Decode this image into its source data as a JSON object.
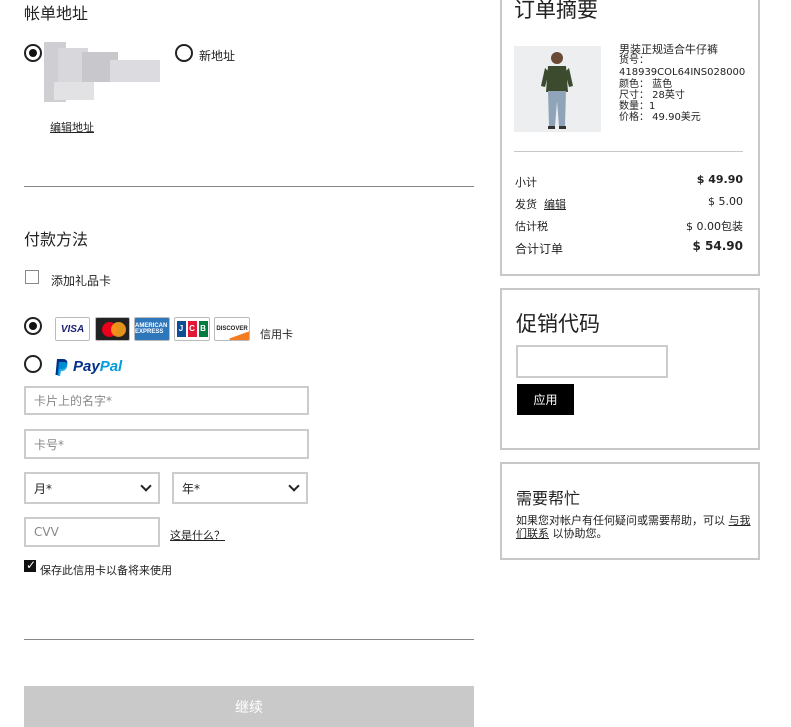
{
  "billing": {
    "title": "帐单地址",
    "new_address_label": "新地址",
    "edit_address_label": "编辑地址"
  },
  "payment": {
    "title": "付款方法",
    "gift_card_label": "添加礼品卡",
    "credit_card_label": "信用卡",
    "card_logos": [
      "VISA",
      "MasterCard",
      "AMERICAN EXPRESS",
      "JCB",
      "DISCOVER"
    ],
    "paypal_label": "PayPal",
    "name_placeholder": "卡片上的名字*",
    "number_placeholder": "卡号*",
    "month_value": "月*",
    "year_value": "年*",
    "cvv_placeholder": "CVV",
    "what_is_this": "这是什么？",
    "save_card_label": "保存此信用卡以备将来使用",
    "save_card_checked": true,
    "continue_label": "继续"
  },
  "summary": {
    "title": "订单摘要",
    "product": {
      "name": "男装正规适合牛仔裤",
      "sku_label": "货号：",
      "sku": "418939COL64INS028000",
      "color": "颜色： 蓝色",
      "size": "尺寸： 28英寸",
      "quantity": "数量：1",
      "price": "价格： 49.90美元"
    },
    "subtotal_label": "小计",
    "subtotal_value": "$ 49.90",
    "shipping_label": "发货",
    "shipping_edit": "编辑",
    "shipping_value": "$ 5.00",
    "tax_label": "估计税",
    "tax_value": "$ 0.00包装",
    "total_label": "合计订单",
    "total_value": "$ 54.90"
  },
  "promo": {
    "title": "促销代码",
    "apply_label": "应用"
  },
  "help": {
    "title": "需要帮忙",
    "text_before": "如果您对帐户有任何疑问或需要帮助，可以",
    "contact_link": "与我们联系",
    "text_after": "以协助您。"
  },
  "colors": {
    "accent": "#000000",
    "disabled_button": "#c9c9c9",
    "border": "#cccccc",
    "paypal_dark": "#003087",
    "paypal_light": "#009cde"
  }
}
